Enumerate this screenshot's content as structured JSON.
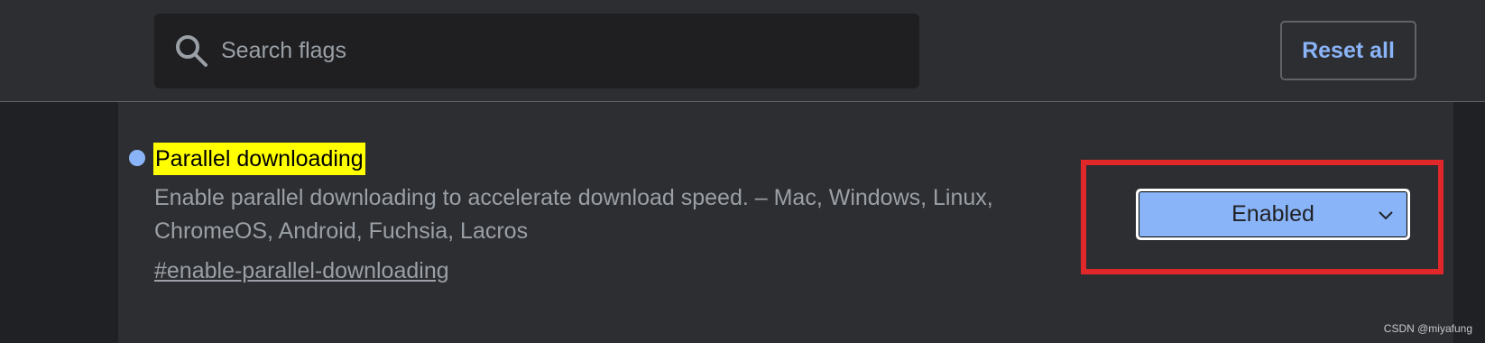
{
  "search": {
    "placeholder": "Search flags",
    "value": "",
    "icon": "search-icon"
  },
  "header": {
    "reset_label": "Reset all"
  },
  "flag": {
    "title": "Parallel downloading",
    "description": "Enable parallel downloading to accelerate download speed. – Mac, Windows, Linux, ChromeOS, Android, Fuchsia, Lacros",
    "link": "#enable-parallel-downloading",
    "state": "Enabled",
    "state_icon": "chevron-down-icon"
  },
  "watermark": "CSDN @miyafung",
  "colors": {
    "background": "#202124",
    "header": "#2d2e32",
    "accent": "#8ab4f8",
    "highlight": "#ffff00",
    "annotation": "#e0282b"
  }
}
